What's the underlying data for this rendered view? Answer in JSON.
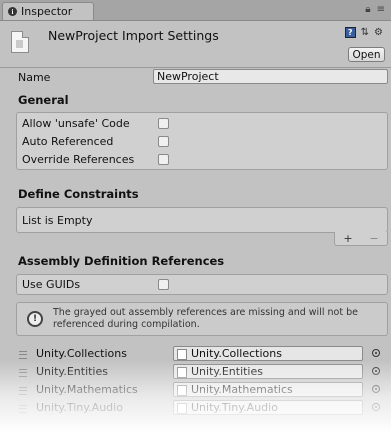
{
  "tab": {
    "icon": "info-icon",
    "label": "Inspector"
  },
  "tab_controls": {
    "lock_icon": "lock-icon",
    "menu_icon": "menu-icon"
  },
  "header": {
    "title": "NewProject Import Settings",
    "open_label": "Open",
    "icons": [
      "help-icon",
      "preset-icon",
      "gear-icon"
    ]
  },
  "name_field": {
    "label": "Name",
    "value": "NewProject"
  },
  "general": {
    "heading": "General",
    "toggles": [
      {
        "label": "Allow 'unsafe' Code",
        "checked": false
      },
      {
        "label": "Auto Referenced",
        "checked": false
      },
      {
        "label": "Override References",
        "checked": false
      }
    ]
  },
  "define_constraints": {
    "heading": "Define Constraints",
    "empty_text": "List is Empty",
    "add_label": "+",
    "remove_label": "−"
  },
  "assembly_refs": {
    "heading": "Assembly Definition References",
    "use_guids_label": "Use GUIDs",
    "use_guids_checked": false,
    "note": "The grayed out assembly references are missing and will not be referenced during compilation.",
    "items": [
      {
        "label": "Unity.Collections",
        "value": "Unity.Collections"
      },
      {
        "label": "Unity.Entities",
        "value": "Unity.Entities"
      },
      {
        "label": "Unity.Mathematics",
        "value": "Unity.Mathematics"
      },
      {
        "label": "Unity.Tiny.Audio",
        "value": "Unity.Tiny.Audio"
      }
    ]
  }
}
